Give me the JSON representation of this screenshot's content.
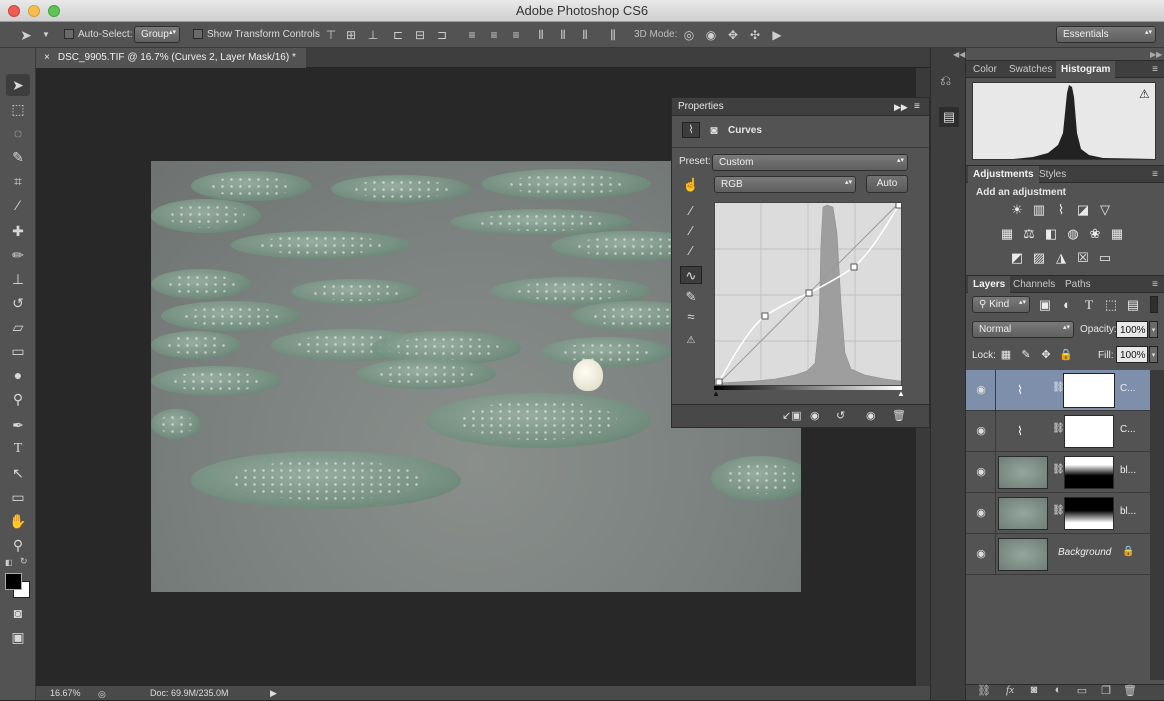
{
  "window": {
    "title": "Adobe Photoshop CS6"
  },
  "options_bar": {
    "auto_select_label": "Auto-Select:",
    "auto_select_value": "Group",
    "show_transform_label": "Show Transform Controls",
    "mode_3d_label": "3D Mode:",
    "workspace": "Essentials"
  },
  "document": {
    "tab_title": "DSC_9905.TIF @ 16.7% (Curves 2, Layer Mask/16) *",
    "close_glyph": "×"
  },
  "status_bar": {
    "zoom": "16.67%",
    "doc_info": "Doc: 69.9M/235.0M"
  },
  "properties": {
    "title": "Properties",
    "adjustment_name": "Curves",
    "preset_label": "Preset:",
    "preset_value": "Custom",
    "channel_value": "RGB",
    "auto_button": "Auto"
  },
  "histogram_panel": {
    "tabs": [
      "Color",
      "Swatches",
      "Histogram"
    ],
    "active_tab": "Histogram",
    "warning_glyph": "⚠"
  },
  "adjustments_panel": {
    "tabs": [
      "Adjustments",
      "Styles"
    ],
    "heading": "Add an adjustment"
  },
  "layers_panel": {
    "tabs": [
      "Layers",
      "Channels",
      "Paths"
    ],
    "kind_filter": "Kind",
    "blend_mode": "Normal",
    "opacity_label": "Opacity:",
    "opacity_value": "100%",
    "lock_label": "Lock:",
    "fill_label": "Fill:",
    "fill_value": "100%",
    "layers": [
      {
        "name": "C...",
        "type": "curves",
        "selected": true
      },
      {
        "name": "C...",
        "type": "curves",
        "selected": false
      },
      {
        "name": "bl...",
        "type": "image-mask-top",
        "selected": false
      },
      {
        "name": "bl...",
        "type": "image-mask-bottom",
        "selected": false
      },
      {
        "name": "Background",
        "type": "background",
        "selected": false
      }
    ]
  },
  "colors": {
    "selected_layer": "#7e8fab",
    "panel_bg": "#535353",
    "canvas_bg": "#282828"
  }
}
